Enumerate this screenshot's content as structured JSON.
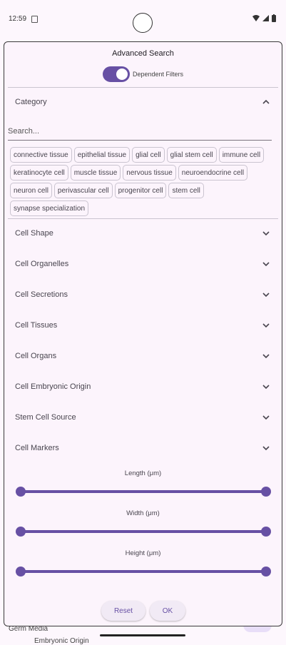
{
  "status": {
    "time": "12:59"
  },
  "dialog": {
    "title": "Advanced Search",
    "dependent_filters_label": "Dependent Filters",
    "category": {
      "label": "Category",
      "search_placeholder": "Search...",
      "chips": [
        "connective tissue",
        "epithelial tissue",
        "glial cell",
        "glial stem cell",
        "immune cell",
        "keratinocyte cell",
        "muscle tissue",
        "nervous tissue",
        "neuroendocrine cell",
        "neuron cell",
        "perivascular cell",
        "progenitor cell",
        "stem cell",
        "synapse specialization"
      ]
    },
    "sections": [
      "Cell Shape",
      "Cell Organelles",
      "Cell Secretions",
      "Cell Tissues",
      "Cell Organs",
      "Cell Embryonic Origin",
      "Stem Cell Source",
      "Cell Markers"
    ],
    "sliders": [
      {
        "label": "Length (μm)",
        "range": [
          0,
          1
        ]
      },
      {
        "label": "Width (μm)",
        "range": [
          0,
          1
        ]
      },
      {
        "label": "Height (μm)",
        "range": [
          0,
          1
        ]
      }
    ],
    "reset_label": "Reset",
    "ok_label": "OK"
  },
  "background": {
    "text1": "Germ Media",
    "text2": "Embryonic Origin"
  },
  "colors": {
    "accent": "#6750a4",
    "surface": "#fcf4fc"
  }
}
